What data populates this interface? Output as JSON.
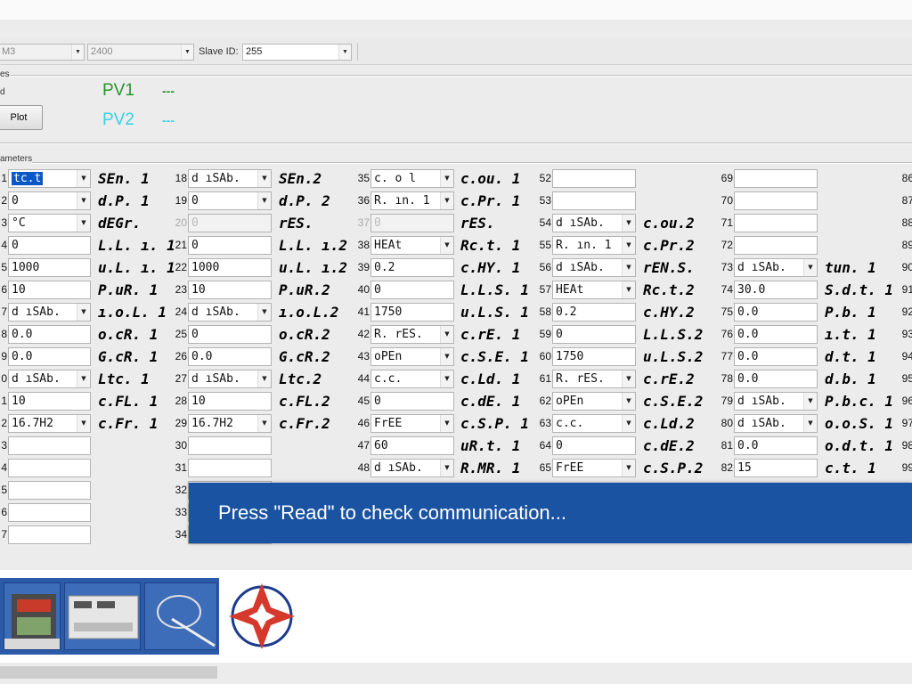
{
  "toolbar": {
    "port": "M3",
    "baud": "2400",
    "slave_label": "Slave ID:",
    "slave_value": "255"
  },
  "values_group": {
    "group_label": "es",
    "row_label": "d",
    "plot_label": "Plot",
    "pv1_label": "PV1",
    "pv1_value": "---",
    "pv2_label": "PV2",
    "pv2_value": "---"
  },
  "parameters_label": "ameters",
  "colors": {
    "pv1": "#27962d",
    "pv2": "#39d2e6",
    "banner": "#1b53a3",
    "selection": "#0a58c6"
  },
  "columns": [
    {
      "rows": [
        {
          "n": "1",
          "v": "tc.t",
          "dd": true,
          "sel": true,
          "code": "SEn. 1"
        },
        {
          "n": "2",
          "v": "0",
          "dd": true,
          "code": "d.P.  1"
        },
        {
          "n": "3",
          "v": "°C",
          "dd": true,
          "code": "dEGr."
        },
        {
          "n": "4",
          "v": "0",
          "code": "L.L. ı. 1"
        },
        {
          "n": "5",
          "v": "1000",
          "code": "u.L. ı. 1"
        },
        {
          "n": "6",
          "v": "10",
          "code": "P.uR. 1"
        },
        {
          "n": "7",
          "v": "d ıSAb.",
          "dd": true,
          "code": "ı.o.L. 1"
        },
        {
          "n": "8",
          "v": "0.0",
          "code": "o.cR. 1"
        },
        {
          "n": "9",
          "v": "0.0",
          "code": "G.cR. 1"
        },
        {
          "n": "0",
          "v": "d ıSAb.",
          "dd": true,
          "code": "Ltc. 1"
        },
        {
          "n": "1",
          "v": "10",
          "code": "c.FL. 1"
        },
        {
          "n": "2",
          "v": "16.7H2",
          "dd": true,
          "code": "c.Fr. 1"
        },
        {
          "n": "3",
          "v": ""
        },
        {
          "n": "4",
          "v": ""
        },
        {
          "n": "5",
          "v": ""
        },
        {
          "n": "6",
          "v": ""
        },
        {
          "n": "7",
          "v": ""
        }
      ]
    },
    {
      "rows": [
        {
          "n": "18",
          "v": "d ıSAb.",
          "dd": true,
          "code": "SEn.2"
        },
        {
          "n": "19",
          "v": "0",
          "dd": true,
          "code": "d.P.  2"
        },
        {
          "n": "20",
          "v": "0",
          "dis": true,
          "code": "rES."
        },
        {
          "n": "21",
          "v": "0",
          "code": "L.L. ı.2"
        },
        {
          "n": "22",
          "v": "1000",
          "code": "u.L. ı.2"
        },
        {
          "n": "23",
          "v": "10",
          "code": "P.uR.2"
        },
        {
          "n": "24",
          "v": "d ıSAb.",
          "dd": true,
          "code": "ı.o.L.2"
        },
        {
          "n": "25",
          "v": "0",
          "code": "o.cR.2"
        },
        {
          "n": "26",
          "v": "0.0",
          "code": "G.cR.2"
        },
        {
          "n": "27",
          "v": "d ıSAb.",
          "dd": true,
          "code": "Ltc.2"
        },
        {
          "n": "28",
          "v": "10",
          "code": "c.FL.2"
        },
        {
          "n": "29",
          "v": "16.7H2",
          "dd": true,
          "code": "c.Fr.2"
        },
        {
          "n": "30",
          "v": ""
        },
        {
          "n": "31",
          "v": ""
        },
        {
          "n": "32",
          "v": ""
        },
        {
          "n": "33",
          "v": ""
        },
        {
          "n": "34",
          "v": ""
        }
      ]
    },
    {
      "rows": [
        {
          "n": "35",
          "v": "c. o l",
          "dd": true,
          "code": "c.ou. 1"
        },
        {
          "n": "36",
          "v": "R. ın. 1",
          "dd": true,
          "code": "c.Pr. 1"
        },
        {
          "n": "37",
          "v": "0",
          "dis": true,
          "code": "rES."
        },
        {
          "n": "38",
          "v": "HEAt",
          "dd": true,
          "code": "Rc.t. 1"
        },
        {
          "n": "39",
          "v": "0.2",
          "code": "c.HY. 1"
        },
        {
          "n": "40",
          "v": "0",
          "code": "L.L.S. 1"
        },
        {
          "n": "41",
          "v": "1750",
          "code": "u.L.S. 1"
        },
        {
          "n": "42",
          "v": "R. rES.",
          "dd": true,
          "code": "c.rE. 1"
        },
        {
          "n": "43",
          "v": "oPEn",
          "dd": true,
          "code": "c.S.E. 1"
        },
        {
          "n": "44",
          "v": "c.c.",
          "dd": true,
          "code": "c.Ld. 1"
        },
        {
          "n": "45",
          "v": "0",
          "code": "c.dE. 1"
        },
        {
          "n": "46",
          "v": "FrEE",
          "dd": true,
          "code": "c.S.P. 1"
        },
        {
          "n": "47",
          "v": "60",
          "code": "uR.t. 1"
        },
        {
          "n": "48",
          "v": "d ıSAb.",
          "dd": true,
          "code": "R.MR. 1"
        }
      ]
    },
    {
      "rows": [
        {
          "n": "52",
          "v": "",
          "code": ""
        },
        {
          "n": "53",
          "v": "",
          "code": ""
        },
        {
          "n": "54",
          "v": "d ıSAb.",
          "dd": true,
          "code": "c.ou.2"
        },
        {
          "n": "55",
          "v": "R. ın. 1",
          "dd": true,
          "code": "c.Pr.2"
        },
        {
          "n": "56",
          "v": "d ıSAb.",
          "dd": true,
          "code": "rEN.S."
        },
        {
          "n": "57",
          "v": "HEAt",
          "dd": true,
          "code": "Rc.t.2"
        },
        {
          "n": "58",
          "v": "0.2",
          "code": "c.HY.2"
        },
        {
          "n": "59",
          "v": "0",
          "code": "L.L.S.2"
        },
        {
          "n": "60",
          "v": "1750",
          "code": "u.L.S.2"
        },
        {
          "n": "61",
          "v": "R. rES.",
          "dd": true,
          "code": "c.rE.2"
        },
        {
          "n": "62",
          "v": "oPEn",
          "dd": true,
          "code": "c.S.E.2"
        },
        {
          "n": "63",
          "v": "c.c.",
          "dd": true,
          "code": "c.Ld.2"
        },
        {
          "n": "64",
          "v": "0",
          "code": "c.dE.2"
        },
        {
          "n": "65",
          "v": "FrEE",
          "dd": true,
          "code": "c.S.P.2"
        }
      ]
    },
    {
      "rows": [
        {
          "n": "69",
          "v": "",
          "code": ""
        },
        {
          "n": "70",
          "v": "",
          "code": ""
        },
        {
          "n": "71",
          "v": "",
          "code": ""
        },
        {
          "n": "72",
          "v": "",
          "code": ""
        },
        {
          "n": "73",
          "v": "d ıSAb.",
          "dd": true,
          "code": "tun. 1"
        },
        {
          "n": "74",
          "v": "30.0",
          "code": "S.d.t. 1"
        },
        {
          "n": "75",
          "v": "0.0",
          "code": "P.b.  1"
        },
        {
          "n": "76",
          "v": "0.0",
          "code": "ı.t.  1"
        },
        {
          "n": "77",
          "v": "0.0",
          "code": "d.t.  1"
        },
        {
          "n": "78",
          "v": "0.0",
          "code": "d.b.  1"
        },
        {
          "n": "79",
          "v": "d ıSAb.",
          "dd": true,
          "code": "P.b.c. 1"
        },
        {
          "n": "80",
          "v": "d ıSAb.",
          "dd": true,
          "code": "o.o.S. 1"
        },
        {
          "n": "81",
          "v": "0.0",
          "code": "o.d.t. 1"
        },
        {
          "n": "82",
          "v": "15",
          "code": "c.t.  1"
        }
      ]
    },
    {
      "rows": [
        {
          "n": "86"
        },
        {
          "n": "87"
        },
        {
          "n": "88"
        },
        {
          "n": "89"
        },
        {
          "n": "90"
        },
        {
          "n": "91"
        },
        {
          "n": "92"
        },
        {
          "n": "93"
        },
        {
          "n": "94"
        },
        {
          "n": "95"
        },
        {
          "n": "96"
        },
        {
          "n": "97"
        },
        {
          "n": "98"
        },
        {
          "n": "99"
        }
      ]
    }
  ],
  "banner_text": "Press \"Read\" to check communication..."
}
